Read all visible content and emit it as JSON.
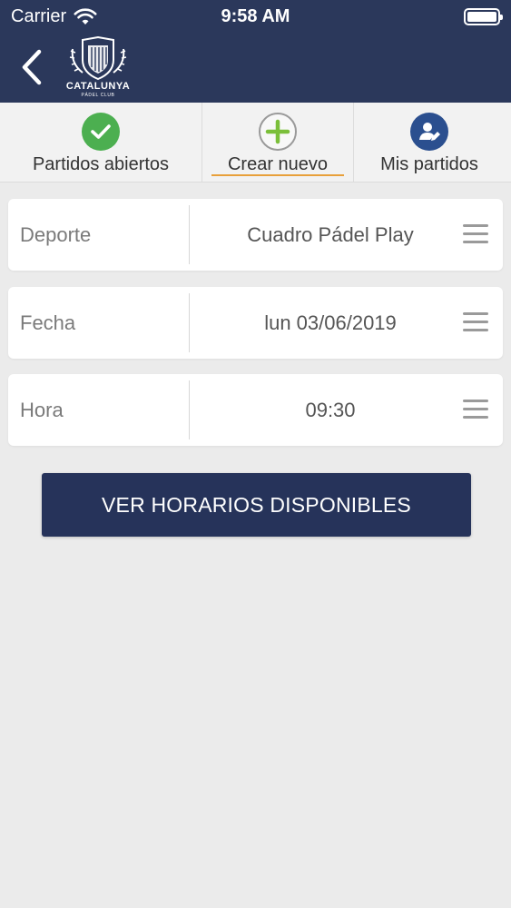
{
  "status_bar": {
    "carrier": "Carrier",
    "time": "9:58 AM"
  },
  "header": {
    "logo_brand": "CATALUNYA",
    "logo_sub": "PÁDEL CLUB",
    "bar_color": "#2b385b"
  },
  "tabs": [
    {
      "label": "Partidos abiertos",
      "icon": "check-circle-icon",
      "color": "#4caf50"
    },
    {
      "label": "Crear nuevo",
      "icon": "plus-circle-icon",
      "color": "#7bbf3a",
      "active": true
    },
    {
      "label": "Mis partidos",
      "icon": "user-edit-icon",
      "color": "#2b4f8f"
    }
  ],
  "form": {
    "sport": {
      "label": "Deporte",
      "value": "Cuadro Pádel Play"
    },
    "date": {
      "label": "Fecha",
      "value": "lun 03/06/2019"
    },
    "time": {
      "label": "Hora",
      "value": "09:30"
    }
  },
  "actions": {
    "show_slots": "VER HORARIOS DISPONIBLES"
  }
}
